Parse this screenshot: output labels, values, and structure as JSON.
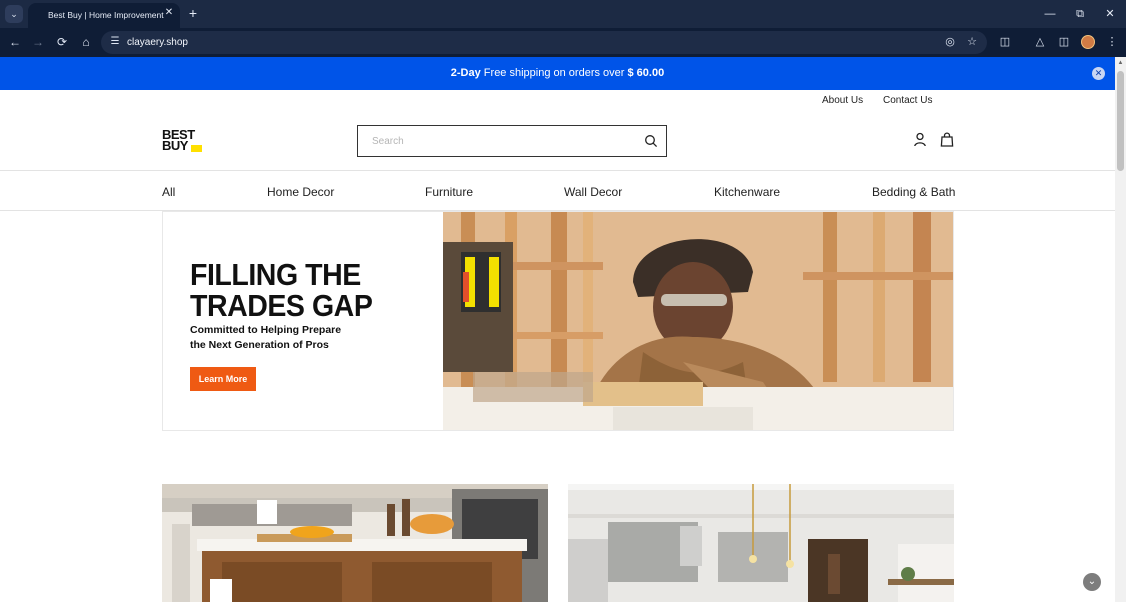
{
  "browser": {
    "tab_title": "Best Buy | Home Improvement",
    "url": "clayaery.shop",
    "icons": {
      "tab_menu": "chevron-down-icon",
      "tab_close": "close-icon",
      "new_tab": "plus-icon",
      "back": "arrow-left-icon",
      "forward": "arrow-right-icon",
      "reload": "reload-icon",
      "home": "home-icon",
      "site_info": "tune-icon",
      "eye_off": "eye-off-icon",
      "bookmark": "star-icon",
      "extensions": "puzzle-icon",
      "labs": "flask-icon",
      "sidepanel": "side-panel-icon",
      "profile": "avatar",
      "menu": "kebab-icon",
      "minimize": "minimize-icon",
      "restore": "restore-icon",
      "close": "close-icon"
    }
  },
  "promo": {
    "bold_prefix": "2-Day",
    "text": " Free shipping on orders over ",
    "amount": "$ 60.00",
    "color": "#0054e8"
  },
  "header": {
    "utility_links": [
      "About Us",
      "Contact Us"
    ],
    "logo": {
      "line1": "BEST",
      "line2": "BUY",
      "tag_color": "#ffe000"
    },
    "search": {
      "placeholder": "Search",
      "value": ""
    },
    "icons": [
      "user-icon",
      "shopping-bag-icon"
    ]
  },
  "nav": {
    "items": [
      "All",
      "Home Decor",
      "Furniture",
      "Wall Decor",
      "Kitchenware",
      "Bedding & Bath"
    ]
  },
  "hero": {
    "title_line1": "FILLING THE",
    "title_line2": "TRADES GAP",
    "subtitle_line1": "Committed to Helping Prepare",
    "subtitle_line2": "the Next Generation of Pros",
    "cta": "Learn More",
    "cta_color": "#ef5a13"
  },
  "cards": [
    "kitchen-island-image",
    "modern-kitchen-image"
  ]
}
